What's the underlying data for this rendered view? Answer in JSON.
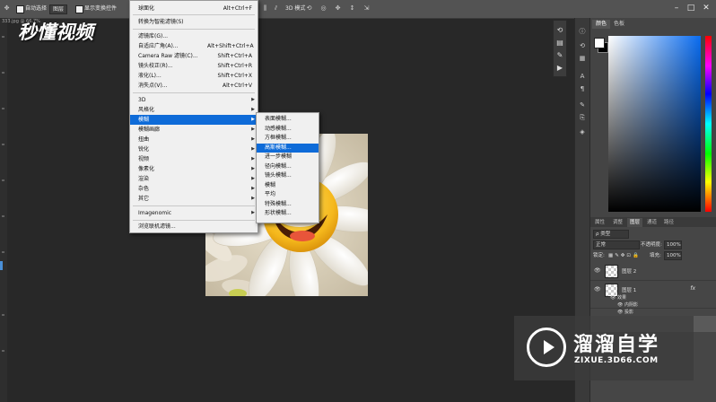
{
  "options_bar": {
    "auto_select_label": "自动选择",
    "auto_select_value": "图层",
    "show_transform_label": "显示变换控件",
    "mode_3d_label": "3D 模式"
  },
  "logo": {
    "text": "秒懂视频"
  },
  "doc_tab": {
    "label": "333.jpg @ 66.7%"
  },
  "filter_menu": {
    "top_items": [
      {
        "label": "球面化",
        "shortcut": "Alt+Ctrl+F"
      },
      {
        "label": "转换为智能滤镜(S)",
        "shortcut": ""
      }
    ],
    "special_items": [
      {
        "label": "滤镜库(G)...",
        "shortcut": ""
      },
      {
        "label": "自适应广角(A)...",
        "shortcut": "Alt+Shift+Ctrl+A"
      },
      {
        "label": "Camera Raw 滤镜(C)...",
        "shortcut": "Shift+Ctrl+A"
      },
      {
        "label": "镜头校正(R)...",
        "shortcut": "Shift+Ctrl+R"
      },
      {
        "label": "液化(L)...",
        "shortcut": "Shift+Ctrl+X"
      },
      {
        "label": "消失点(V)...",
        "shortcut": "Alt+Ctrl+V"
      }
    ],
    "category_items": [
      {
        "label": "3D"
      },
      {
        "label": "风格化"
      },
      {
        "label": "模糊",
        "highlighted": true
      },
      {
        "label": "模糊画廊"
      },
      {
        "label": "扭曲"
      },
      {
        "label": "锐化"
      },
      {
        "label": "视频"
      },
      {
        "label": "像素化"
      },
      {
        "label": "渲染"
      },
      {
        "label": "杂色"
      },
      {
        "label": "其它"
      }
    ],
    "plugin_items": [
      {
        "label": "Imagenomic"
      }
    ],
    "browse_label": "浏览联机滤镜..."
  },
  "blur_submenu": {
    "items": [
      {
        "label": "表面模糊..."
      },
      {
        "label": "动感模糊..."
      },
      {
        "label": "方框模糊..."
      },
      {
        "label": "高斯模糊...",
        "highlighted": true
      },
      {
        "label": "进一步模糊"
      },
      {
        "label": "径向模糊..."
      },
      {
        "label": "镜头模糊..."
      },
      {
        "label": "模糊"
      },
      {
        "label": "平均"
      },
      {
        "label": "特殊模糊..."
      },
      {
        "label": "形状模糊..."
      }
    ]
  },
  "color_panel": {
    "tabs": [
      {
        "label": "颜色",
        "active": true
      },
      {
        "label": "色板",
        "active": false
      }
    ],
    "foreground_color": "#ffffff",
    "background_color": "#000000",
    "field_hue_color": "#0a6cf0"
  },
  "layers_panel": {
    "tabs": [
      {
        "label": "属性",
        "active": false
      },
      {
        "label": "调整",
        "active": false
      },
      {
        "label": "图层",
        "active": true
      },
      {
        "label": "通道",
        "active": false
      },
      {
        "label": "路径",
        "active": false
      }
    ],
    "filter_kind": "类型",
    "blend_mode": "正常",
    "opacity_label": "不透明度:",
    "opacity_value": "100%",
    "lock_label": "锁定:",
    "fill_label": "填充:",
    "fill_value": "100%",
    "layers": [
      {
        "name": "图层 2",
        "fx": ""
      },
      {
        "name": "图层 1",
        "fx": "fx"
      }
    ],
    "effects": {
      "title": "效果",
      "items": [
        "内阴影",
        "投影"
      ]
    }
  },
  "watermark": {
    "title": "溜溜自学",
    "url": "ZIXUE.3D66.COM"
  }
}
